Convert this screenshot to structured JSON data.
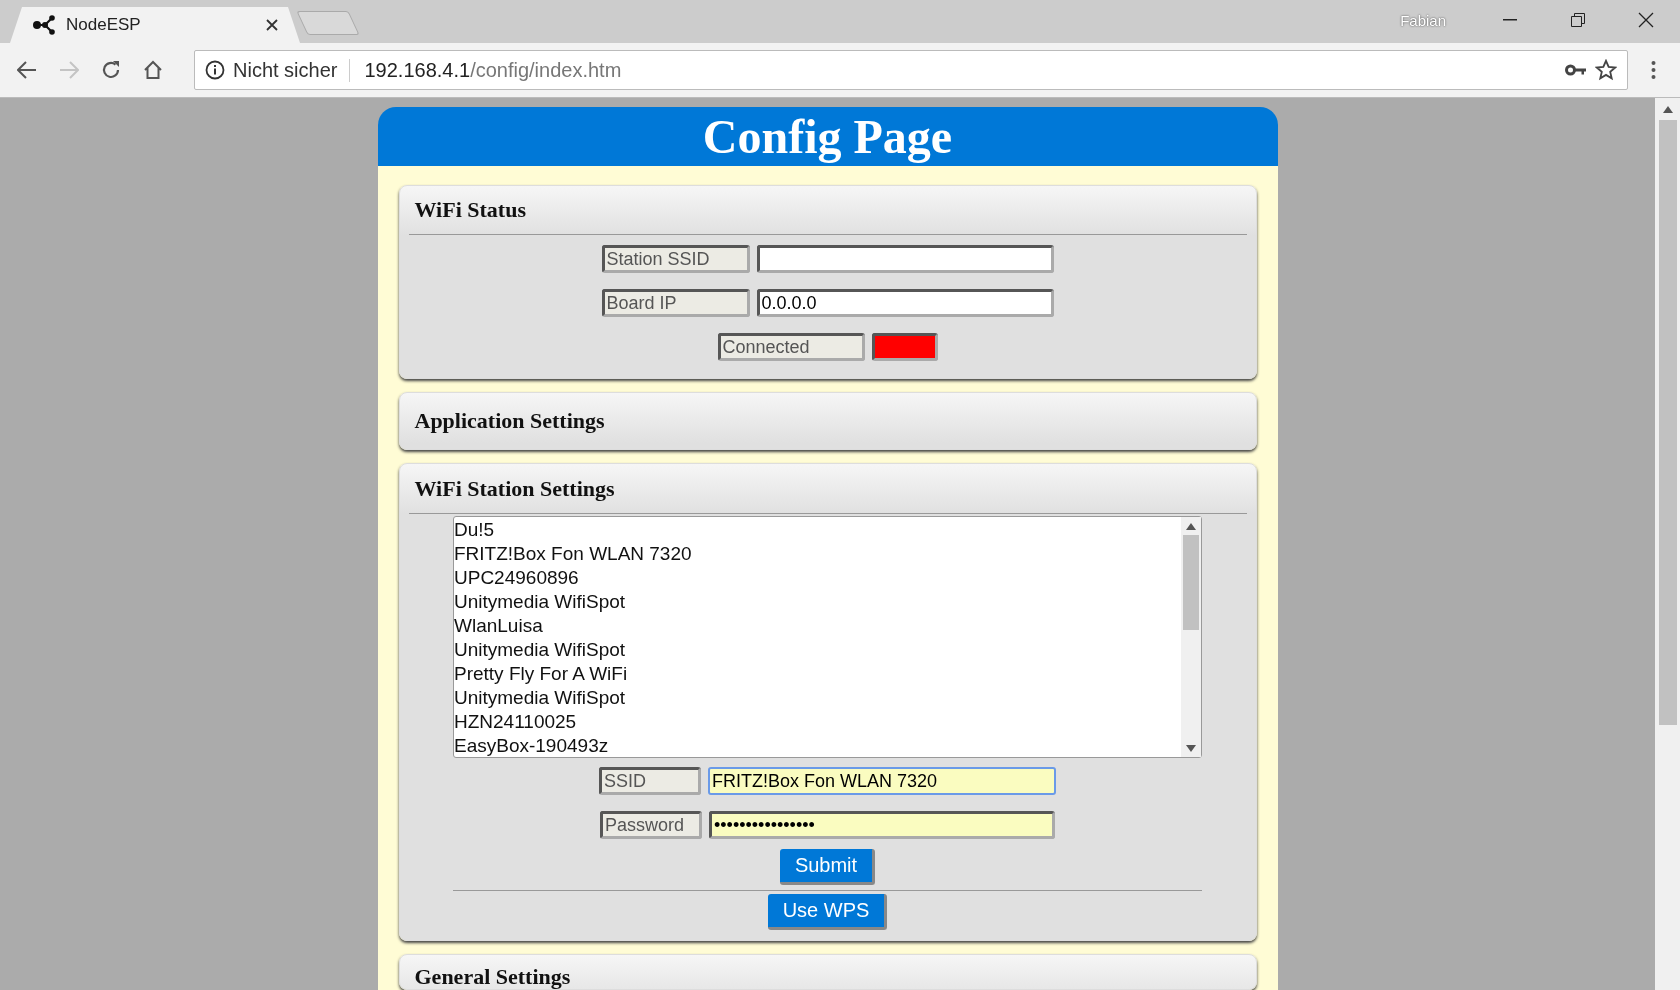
{
  "browser": {
    "tabs": [
      {
        "title": "NodeESP",
        "selected": true
      }
    ],
    "profile": "Fabian",
    "security": "Nicht sicher",
    "url_host": "192.168.4.1",
    "url_path": "/config/index.htm",
    "forward_disabled": true
  },
  "page": {
    "title": "Config Page",
    "sections": [
      {
        "kind": "status",
        "title": "WiFi Status",
        "fields": [
          {
            "label": "Station SSID"
          },
          {
            "label": "Board IP",
            "value": "0.0.0.0"
          }
        ],
        "indicator": {
          "label": "Connected",
          "connected": false
        }
      },
      {
        "kind": "collapsed",
        "title": "Application Settings"
      },
      {
        "kind": "station",
        "title": "WiFi Station Settings",
        "networks": [
          {
            "name": "Du!5",
            "selected": false
          },
          {
            "name": "FRITZ!Box Fon WLAN 7320",
            "selected": false
          },
          {
            "name": "UPC24960896",
            "selected": false
          },
          {
            "name": "Unitymedia WifiSpot",
            "selected": false
          },
          {
            "name": "WlanLuisa",
            "selected": false
          },
          {
            "name": "Unitymedia WifiSpot",
            "selected": false
          },
          {
            "name": "Pretty Fly For A WiFi",
            "selected": false
          },
          {
            "name": "Unitymedia WifiSpot",
            "selected": false
          },
          {
            "name": "HZN24110025",
            "selected": false
          },
          {
            "name": "EasyBox-190493z",
            "selected": false
          }
        ],
        "ssid": {
          "label": "SSID",
          "value": "FRITZ!Box Fon WLAN 7320",
          "focused": true
        },
        "password": {
          "label": "Password",
          "value": "••••••••••••••••",
          "focused": false
        },
        "submit": "Submit",
        "wps": "Use WPS"
      },
      {
        "kind": "collapsed",
        "title": "General Settings"
      }
    ]
  }
}
